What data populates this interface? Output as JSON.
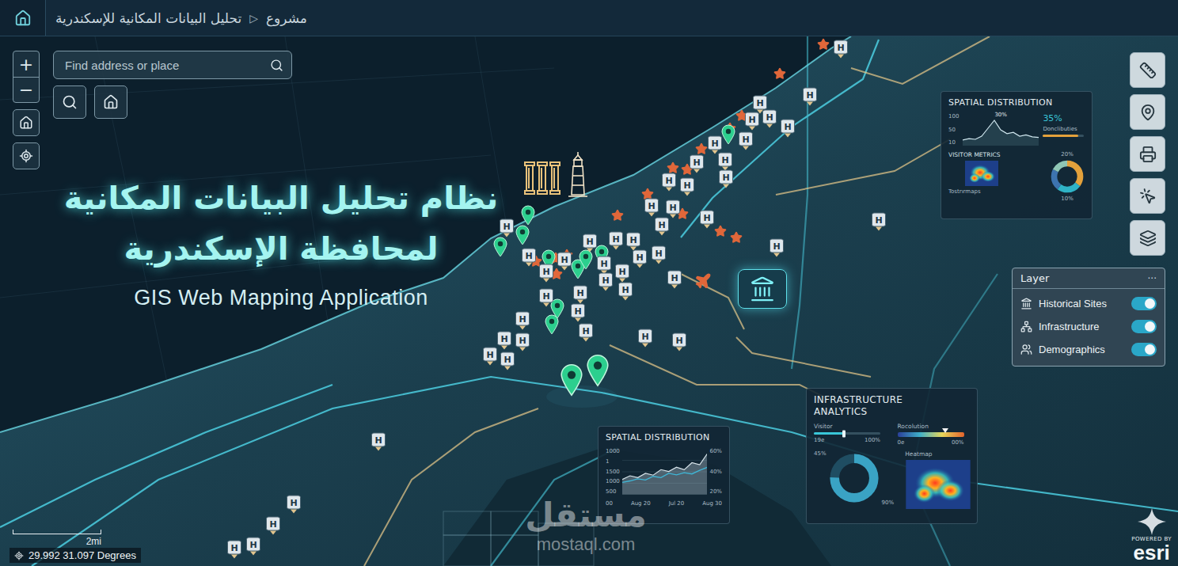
{
  "topbar": {
    "breadcrumb": [
      "مشروع",
      "تحليل البيانات المكانية للإسكندرية"
    ],
    "separator": "▷"
  },
  "map_controls": {
    "zoom_in": "+",
    "zoom_out": "−"
  },
  "search": {
    "placeholder": "Find address or place"
  },
  "title": {
    "lines": [
      "نظام تحليل البيانات المكانية",
      "لمحافظة الإسكندرية"
    ],
    "subtitle": "GIS Web Mapping Application"
  },
  "layer_panel": {
    "title": "Layer",
    "menu": "···",
    "items": [
      {
        "label": "Historical Sites",
        "on": true
      },
      {
        "label": "Infrastructure",
        "on": true
      },
      {
        "label": "Demographics",
        "on": true
      }
    ]
  },
  "spatial_panel_top": {
    "title": "SPATIAL DISTRIBUTION",
    "y_ticks": [
      "100",
      "50",
      "10"
    ],
    "peak_label": "30%",
    "series": [
      18,
      22,
      20,
      30,
      55,
      80,
      50,
      38,
      42,
      30,
      34,
      28,
      26
    ],
    "stat": "35%",
    "stat_label": "Donclibuties",
    "stat_level": 0.85,
    "metrics_title": "VISITOR METRICS",
    "metrics_caption": "Tostrırmaps",
    "donut_label_top": "20%",
    "donut_label_bottom": "10%",
    "donut": [
      {
        "value": 35,
        "color": "#e3a13b"
      },
      {
        "value": 25,
        "color": "#2fb3c6"
      },
      {
        "value": 22,
        "color": "#3d74b0"
      },
      {
        "value": 18,
        "color": "#8fc7b5"
      }
    ]
  },
  "spatial_panel_bottom": {
    "title": "SPATIAL DISTRIBUTION",
    "y_ticks": [
      "1000",
      "1",
      "1500",
      "1000",
      "500"
    ],
    "y_ticks_right": [
      "60%",
      "40%",
      "20%"
    ],
    "x_ticks": [
      "00",
      "Aug 20",
      "Jul 20",
      "Aug 30"
    ],
    "series": [
      {
        "kind": "area",
        "values": [
          500,
          620,
          560,
          700,
          640,
          820,
          760,
          900,
          820,
          1050,
          980,
          1350
        ]
      },
      {
        "kind": "line",
        "values": [
          400,
          450,
          520,
          480,
          600,
          560,
          700,
          650,
          720,
          680,
          800,
          900
        ]
      }
    ]
  },
  "infrastructure_panel": {
    "title": "INFRASTRUCTURE ANALYTICS",
    "visitor": {
      "label": "Visitor",
      "min": "19e",
      "max": "100%",
      "level": 0.45
    },
    "resolution": {
      "label": "Rocolution",
      "min": "0e",
      "max": "00%",
      "level": 0.72
    },
    "donut": {
      "top_label": "45%",
      "bottom_label": "90%",
      "level": 0.75
    },
    "heatmap_label": "Heatmap"
  },
  "scale_bar": {
    "label": "2mi"
  },
  "coordinates": "29.992 31.097 Degrees",
  "esri": {
    "powered_by": "POWERED BY",
    "name": "esri"
  },
  "watermark": {
    "arabic": "مستقل",
    "latin": "mostaql.com"
  },
  "markers": [
    {
      "kind": "hospital",
      "label": "H"
    },
    {
      "kind": "hospital",
      "label": "H"
    },
    {
      "kind": "hospital",
      "label": "H"
    },
    {
      "kind": "hospital",
      "label": "H"
    },
    {
      "kind": "hospital",
      "label": "H"
    },
    {
      "kind": "hospital",
      "label": "H"
    },
    {
      "kind": "hospital",
      "label": "H"
    },
    {
      "kind": "hospital",
      "label": "H"
    },
    {
      "kind": "hospital",
      "label": "H"
    },
    {
      "kind": "hospital",
      "label": "H"
    },
    {
      "kind": "hospital",
      "label": "H"
    },
    {
      "kind": "hospital",
      "label": "H"
    },
    {
      "kind": "hospital",
      "label": "H"
    },
    {
      "kind": "hospital",
      "label": "H"
    },
    {
      "kind": "hospital",
      "label": "H"
    },
    {
      "kind": "hospital",
      "label": "H"
    },
    {
      "kind": "hospital",
      "label": "H"
    },
    {
      "kind": "hospital",
      "label": "H"
    },
    {
      "kind": "hospital",
      "label": "H"
    },
    {
      "kind": "hospital",
      "label": "H"
    },
    {
      "kind": "hospital",
      "label": "H"
    },
    {
      "kind": "hospital",
      "label": "H"
    },
    {
      "kind": "hospital",
      "label": "H"
    },
    {
      "kind": "hospital",
      "label": "H"
    },
    {
      "kind": "hospital",
      "label": "H"
    },
    {
      "kind": "hospital",
      "label": "H"
    },
    {
      "kind": "hospital",
      "label": "H"
    },
    {
      "kind": "hospital",
      "label": "H"
    },
    {
      "kind": "hospital",
      "label": "H"
    },
    {
      "kind": "hospital",
      "label": "H"
    },
    {
      "kind": "hospital",
      "label": "H"
    },
    {
      "kind": "hospital",
      "label": "H"
    },
    {
      "kind": "hospital",
      "label": "H"
    },
    {
      "kind": "hospital",
      "label": "H"
    },
    {
      "kind": "hospital",
      "label": "H"
    },
    {
      "kind": "hospital",
      "label": "H"
    },
    {
      "kind": "hospital",
      "label": "H"
    },
    {
      "kind": "hospital",
      "label": "H"
    },
    {
      "kind": "hospital",
      "label": "H"
    },
    {
      "kind": "hospital",
      "label": "H"
    },
    {
      "kind": "hospital",
      "label": "H"
    },
    {
      "kind": "hospital",
      "label": "H"
    },
    {
      "kind": "hospital",
      "label": "H"
    },
    {
      "kind": "hospital",
      "label": "H"
    },
    {
      "kind": "hospital",
      "label": "H"
    },
    {
      "kind": "hospital",
      "label": "H"
    },
    {
      "kind": "hospital",
      "label": "H"
    },
    {
      "kind": "hospital",
      "label": "H"
    },
    {
      "kind": "hospital",
      "label": "H"
    },
    {
      "kind": "star"
    },
    {
      "kind": "star"
    },
    {
      "kind": "star"
    },
    {
      "kind": "star"
    },
    {
      "kind": "star"
    },
    {
      "kind": "star"
    },
    {
      "kind": "star"
    },
    {
      "kind": "star"
    },
    {
      "kind": "star"
    },
    {
      "kind": "star"
    },
    {
      "kind": "star"
    },
    {
      "kind": "star"
    },
    {
      "kind": "star"
    },
    {
      "kind": "star"
    },
    {
      "kind": "star"
    },
    {
      "kind": "star"
    },
    {
      "kind": "pin"
    },
    {
      "kind": "pin"
    },
    {
      "kind": "pin"
    },
    {
      "kind": "pin"
    },
    {
      "kind": "pin"
    },
    {
      "kind": "pin"
    },
    {
      "kind": "pin"
    },
    {
      "kind": "pin"
    },
    {
      "kind": "pin"
    },
    {
      "kind": "pin"
    },
    {
      "kind": "pin"
    },
    {
      "kind": "pin"
    },
    {
      "kind": "airport"
    },
    {
      "kind": "museum"
    },
    {
      "kind": "columns"
    },
    {
      "kind": "lighthouse"
    }
  ]
}
